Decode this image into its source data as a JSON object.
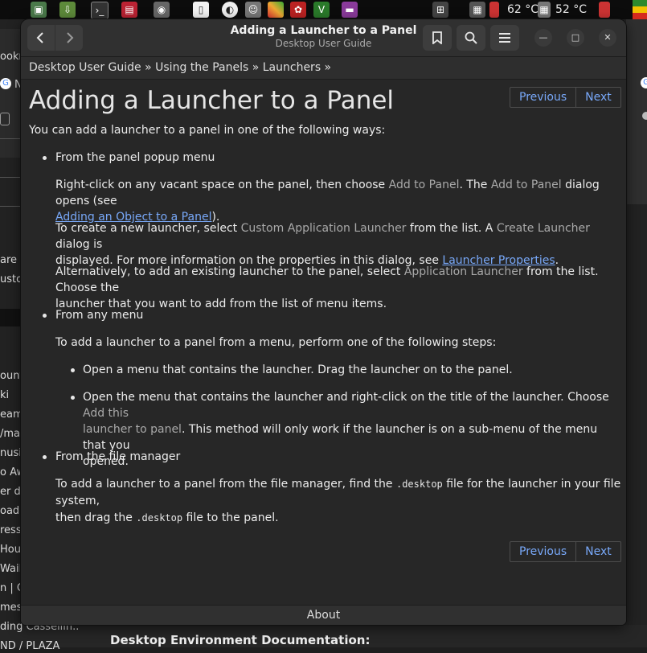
{
  "topbar": {
    "temp1": "62 °C",
    "temp2": "52 °C",
    "icons": [
      "image-viewer-icon",
      "download-icon",
      "terminal-icon",
      "archive-icon",
      "camera-icon",
      "document-icon",
      "disc-icon",
      "chat-icon",
      "color-picker-icon",
      "settings-icon",
      "vim-icon",
      "media-player-icon",
      "grid-icon",
      "calculator-icon",
      "cpu-icon"
    ]
  },
  "background": {
    "left_items": [
      "ookn",
      "N",
      "are",
      "usto",
      "ount",
      "ki",
      "eam",
      "/mal",
      "nusi",
      "o Aw",
      "er d",
      "oad",
      "ress",
      "Hous",
      "Wail",
      "n | C",
      "mes",
      "ding Cassellin..",
      "ND / PLAZA"
    ],
    "bottom_title": "Desktop Environment Documentation:"
  },
  "window": {
    "title": "Adding a Launcher to a Panel",
    "subtitle": "Desktop User Guide",
    "breadcrumb": [
      "Desktop User Guide",
      "Using the Panels",
      "Launchers"
    ],
    "breadcrumb_sep": " » ",
    "nav": {
      "previous": "Previous",
      "next": "Next"
    },
    "page_title": "Adding a Launcher to a Panel",
    "intro": "You can add a launcher to a panel in one of the following ways:",
    "s1": {
      "heading": "From the panel popup menu",
      "p1_a": "Right-click on any vacant space on the panel, then choose ",
      "p1_gui1": "Add to Panel",
      "p1_b": ". The ",
      "p1_gui2": "Add to Panel",
      "p1_c": " dialog opens (see",
      "p1_link": "Adding an Object to a Panel",
      "p1_d": ").",
      "p2_a": "To create a new launcher, select ",
      "p2_gui1": "Custom Application Launcher",
      "p2_b": " from the list. A ",
      "p2_gui2": "Create Launcher",
      "p2_c": " dialog is",
      "p2_d": "displayed. For more information on the properties in this dialog, see ",
      "p2_link": "Launcher Properties",
      "p2_e": ".",
      "p3_a": "Alternatively, to add an existing launcher to the panel, select ",
      "p3_gui": "Application Launcher",
      "p3_b": " from the list. Choose the",
      "p3_c": "launcher that you want to add from the list of menu items."
    },
    "s2": {
      "heading": "From any menu",
      "p1": "To add a launcher to a panel from a menu, perform one of the following steps:",
      "step1": "Open a menu that contains the launcher. Drag the launcher on to the panel.",
      "step2_a": "Open the menu that contains the launcher and right-click on the title of the launcher. Choose ",
      "step2_gui1": "Add this",
      "step2_gui2": "launcher to panel",
      "step2_b": ". This method will only work if the launcher is on a sub-menu of the menu that you",
      "step2_c": "opened."
    },
    "s3": {
      "heading": "From the file manager",
      "p1_a": "To add a launcher to a panel from the file manager, find the ",
      "p1_code1": ".desktop",
      "p1_b": " file for the launcher in your file system,",
      "p1_c": "then drag the ",
      "p1_code2": ".desktop",
      "p1_d": " file to the panel."
    },
    "footer": "About"
  }
}
